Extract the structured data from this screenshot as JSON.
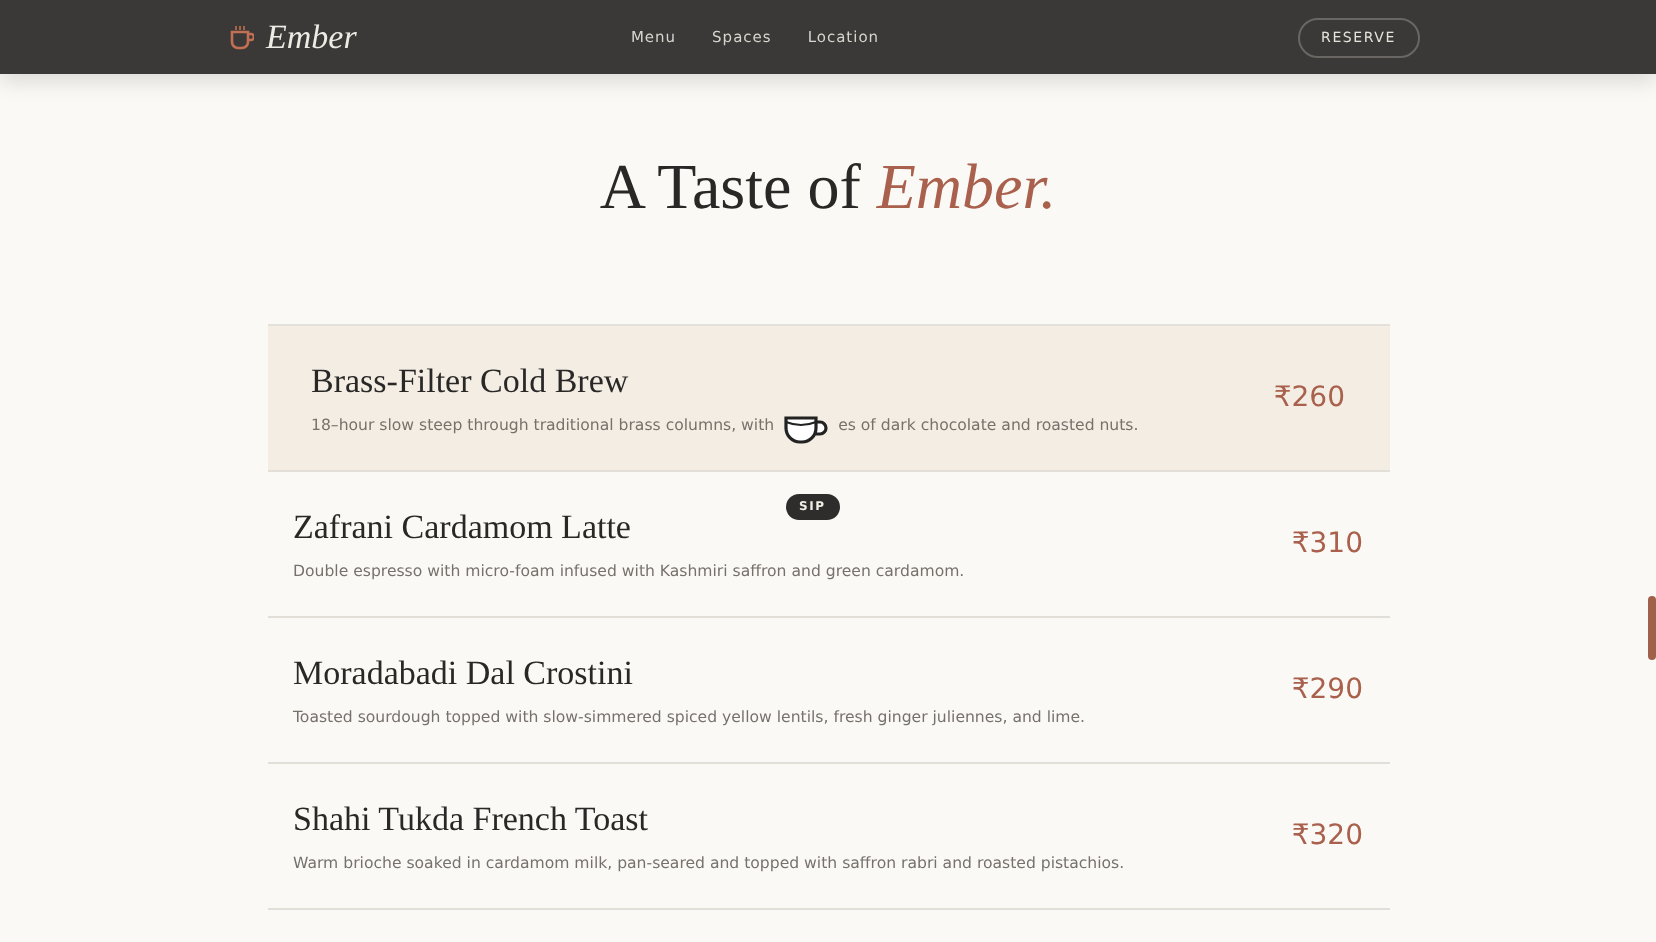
{
  "nav": {
    "brand": "Ember",
    "links": [
      "Menu",
      "Spaces",
      "Location"
    ],
    "cta": "RESERVE"
  },
  "heading": {
    "text": "A Taste of ",
    "accent": "Ember."
  },
  "items": [
    {
      "name": "Brass-Filter Cold Brew",
      "description_parts": [
        "18–hour slow steep through traditional brass columns, with",
        "es of dark chocolate and roasted nuts."
      ],
      "price": "₹260",
      "selected": true
    },
    {
      "name": "Zafrani Cardamom Latte",
      "description_parts": [
        "Double espresso with micro-foam infused with Kashmiri saffron and green cardamom."
      ],
      "price": "₹310",
      "selected": false
    },
    {
      "name": "Moradabadi Dal Crostini",
      "description_parts": [
        "Toasted sourdough topped with slow-simmered spiced yellow lentils, fresh ginger juliennes, and lime."
      ],
      "price": "₹290",
      "selected": false
    },
    {
      "name": "Shahi Tukda French Toast",
      "description_parts": [
        "Warm brioche soaked in cardamom milk, pan-seared and topped with saffron rabri and roasted pistachios."
      ],
      "price": "₹320",
      "selected": false
    }
  ],
  "cursor": {
    "label": "SIP"
  }
}
